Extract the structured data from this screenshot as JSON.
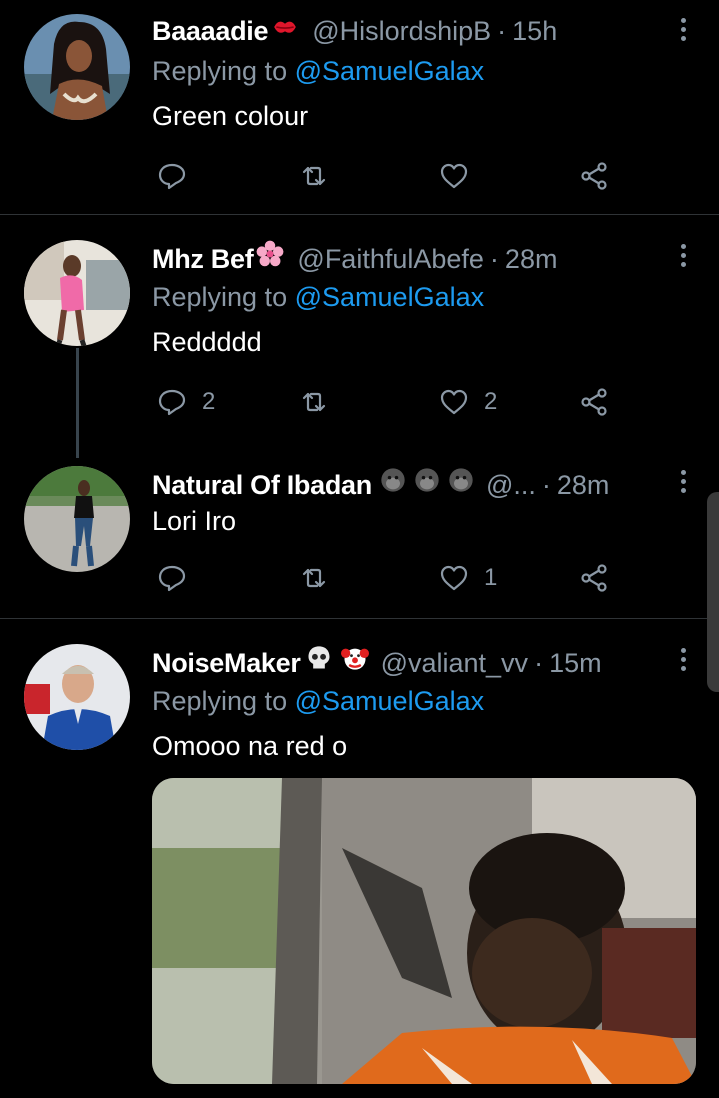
{
  "tweets": [
    {
      "name": "Baaaadie",
      "emoji": "kiss-mark-emoji",
      "handle": "@HislordshipB",
      "time": "15h",
      "replying_prefix": "Replying to",
      "replying_to": "@SamuelGalax",
      "text": "Green colour",
      "replies": "",
      "likes": ""
    },
    {
      "name": "Mhz Bef",
      "emoji": "cherry-blossom-emoji",
      "handle": "@FaithfulAbefe",
      "time": "28m",
      "replying_prefix": "Replying to",
      "replying_to": "@SamuelGalax",
      "text": "Reddddd",
      "replies": "2",
      "likes": "2"
    },
    {
      "name": "Natural Of Ibadan",
      "emoji": "gorilla-emoji",
      "handle": "@...",
      "time": "28m",
      "text": "Lori Iro",
      "replies": "",
      "likes": "1"
    },
    {
      "name": "NoiseMaker",
      "emoji": "skull-clown-emoji",
      "handle": "@valiant_vv",
      "time": "15m",
      "replying_prefix": "Replying to",
      "replying_to": "@SamuelGalax",
      "text": "Omooo na red o"
    }
  ],
  "colors": {
    "background": "#000000",
    "text": "#ffffff",
    "muted": "#8b98a5",
    "link": "#1d9bf0",
    "divider": "#2f3336"
  },
  "icons": [
    "reply-icon",
    "retweet-icon",
    "like-icon",
    "share-icon",
    "more-options-icon"
  ]
}
